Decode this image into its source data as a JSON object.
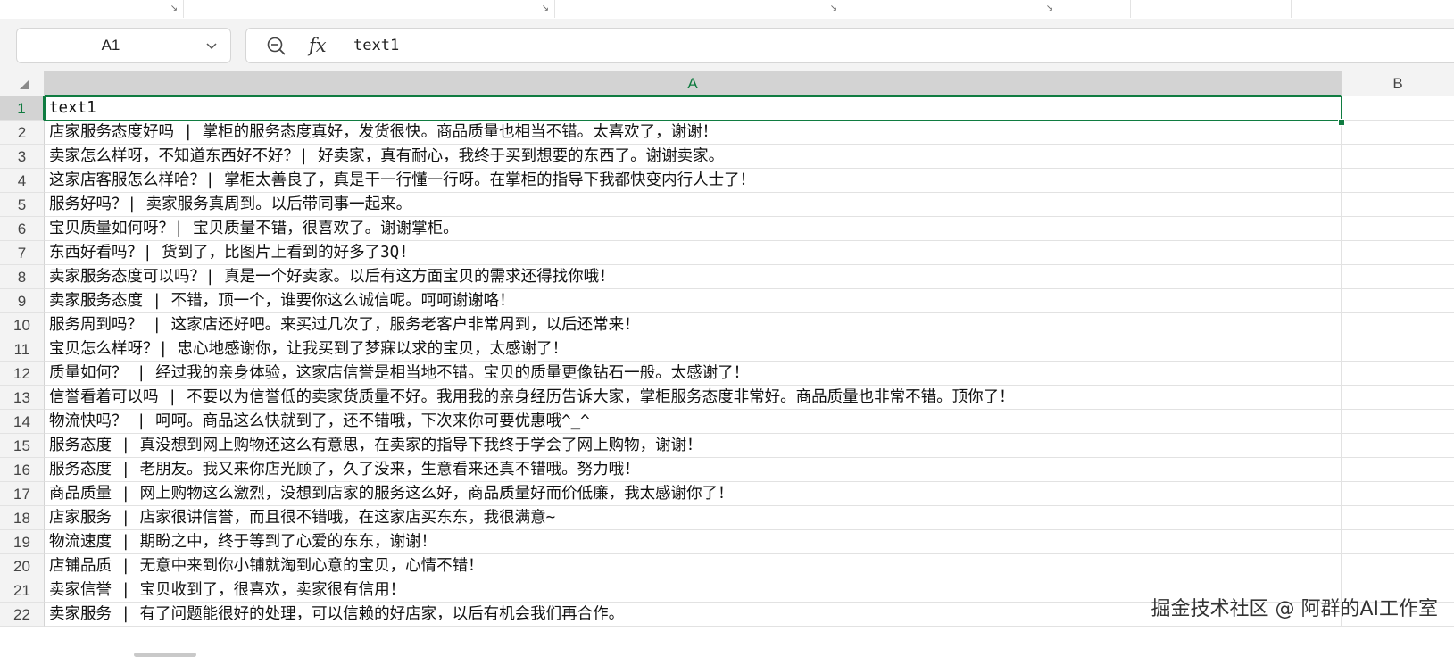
{
  "namebox": {
    "value": "A1"
  },
  "formula_bar": {
    "content": "text1"
  },
  "columns": [
    {
      "label": "A",
      "selected": true
    },
    {
      "label": "B",
      "selected": false
    }
  ],
  "rows": [
    {
      "num": "1",
      "a": "text1"
    },
    {
      "num": "2",
      "a": "店家服务态度好吗 | 掌柜的服务态度真好，发货很快。商品质量也相当不错。太喜欢了，谢谢！"
    },
    {
      "num": "3",
      "a": "卖家怎么样呀，不知道东西好不好？| 好卖家，真有耐心，我终于买到想要的东西了。谢谢卖家。"
    },
    {
      "num": "4",
      "a": "这家店客服怎么样哈？| 掌柜太善良了，真是干一行懂一行呀。在掌柜的指导下我都快变内行人士了！"
    },
    {
      "num": "5",
      "a": "服务好吗？| 卖家服务真周到。以后带同事一起来。"
    },
    {
      "num": "6",
      "a": "宝贝质量如何呀？| 宝贝质量不错，很喜欢了。谢谢掌柜。"
    },
    {
      "num": "7",
      "a": "东西好看吗？| 货到了，比图片上看到的好多了3Q!"
    },
    {
      "num": "8",
      "a": "卖家服务态度可以吗？| 真是一个好卖家。以后有这方面宝贝的需求还得找你哦！"
    },
    {
      "num": "9",
      "a": "卖家服务态度 | 不错，顶一个，谁要你这么诚信呢。呵呵谢谢咯！"
    },
    {
      "num": "10",
      "a": "服务周到吗？ | 这家店还好吧。来买过几次了，服务老客户非常周到，以后还常来！"
    },
    {
      "num": "11",
      "a": "宝贝怎么样呀？| 忠心地感谢你，让我买到了梦寐以求的宝贝，太感谢了！"
    },
    {
      "num": "12",
      "a": "质量如何？ | 经过我的亲身体验，这家店信誉是相当地不错。宝贝的质量更像钻石一般。太感谢了！"
    },
    {
      "num": "13",
      "a": "信誉看着可以吗 | 不要以为信誉低的卖家货质量不好。我用我的亲身经历告诉大家，掌柜服务态度非常好。商品质量也非常不错。顶你了！"
    },
    {
      "num": "14",
      "a": "物流快吗？ | 呵呵。商品这么快就到了，还不错哦，下次来你可要优惠哦^_^"
    },
    {
      "num": "15",
      "a": "服务态度 | 真没想到网上购物还这么有意思，在卖家的指导下我终于学会了网上购物，谢谢！"
    },
    {
      "num": "16",
      "a": "服务态度 | 老朋友。我又来你店光顾了，久了没来，生意看来还真不错哦。努力哦！"
    },
    {
      "num": "17",
      "a": "商品质量 | 网上购物这么激烈，没想到店家的服务这么好，商品质量好而价低廉，我太感谢你了！"
    },
    {
      "num": "18",
      "a": "店家服务 | 店家很讲信誉，而且很不错哦，在这家店买东东，我很满意~"
    },
    {
      "num": "19",
      "a": "物流速度 | 期盼之中，终于等到了心爱的东东，谢谢！"
    },
    {
      "num": "20",
      "a": "店铺品质 | 无意中来到你小铺就淘到心意的宝贝，心情不错！"
    },
    {
      "num": "21",
      "a": "卖家信誉 | 宝贝收到了，很喜欢，卖家很有信用！"
    },
    {
      "num": "22",
      "a": "卖家服务 | 有了问题能很好的处理，可以信赖的好店家，以后有机会我们再合作。"
    }
  ],
  "watermark": "掘金技术社区 @ 阿群的AI工作室",
  "colors": {
    "accent": "#107c41",
    "header_bg": "#f3f3f3",
    "selected_header_bg": "#d3d3d3"
  }
}
